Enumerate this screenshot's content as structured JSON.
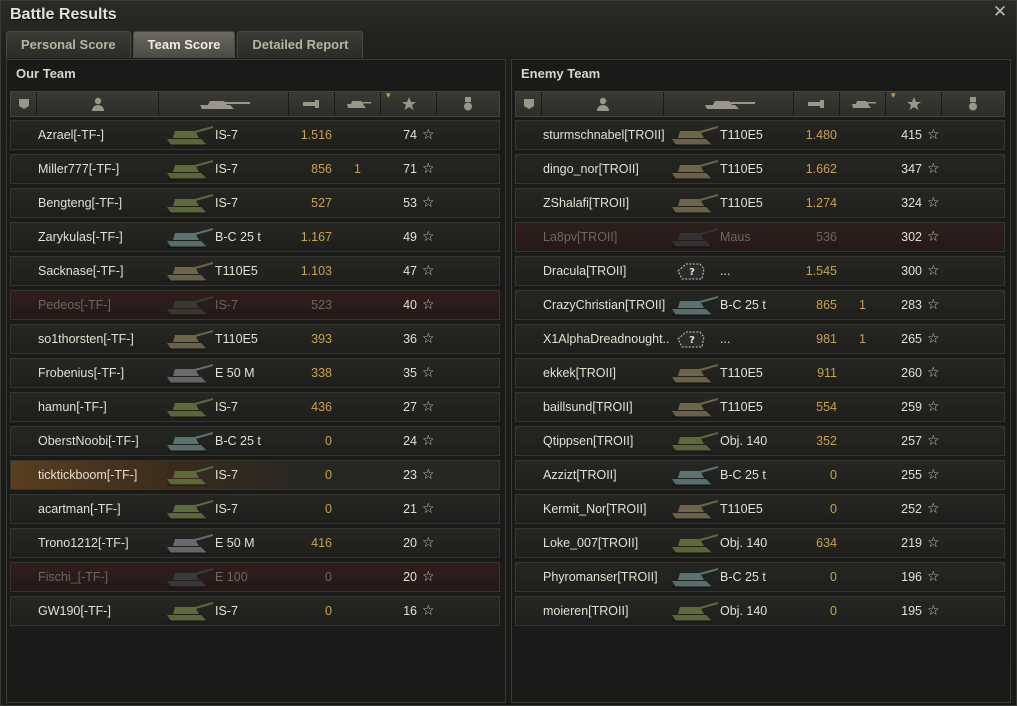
{
  "window": {
    "title": "Battle Results",
    "close_glyph": "✕"
  },
  "tabs": [
    {
      "label": "Personal Score",
      "active": false
    },
    {
      "label": "Team Score",
      "active": true
    },
    {
      "label": "Detailed Report",
      "active": false
    }
  ],
  "our_team": {
    "title": "Our Team",
    "rows": [
      {
        "name": "Azrael[-TF-]",
        "tank": "IS-7",
        "damage": "1.516",
        "kills": "",
        "xp": "74",
        "state": "normal",
        "tank_color": "#5d6b3a"
      },
      {
        "name": "Miller777[-TF-]",
        "tank": "IS-7",
        "damage": "856",
        "kills": "1",
        "xp": "71",
        "state": "normal",
        "tank_color": "#5d6b3a"
      },
      {
        "name": "Bengteng[-TF-]",
        "tank": "IS-7",
        "damage": "527",
        "kills": "",
        "xp": "53",
        "state": "normal",
        "tank_color": "#5d6b3a"
      },
      {
        "name": "Zarykulas[-TF-]",
        "tank": "B-C 25 t",
        "damage": "1.167",
        "kills": "",
        "xp": "49",
        "state": "normal",
        "tank_color": "#5b7371"
      },
      {
        "name": "Sacknase[-TF-]",
        "tank": "T110E5",
        "damage": "1.103",
        "kills": "",
        "xp": "47",
        "state": "normal",
        "tank_color": "#6e6448"
      },
      {
        "name": "Pedeos[-TF-]",
        "tank": "IS-7",
        "damage": "523",
        "kills": "",
        "xp": "40",
        "state": "dead",
        "tank_color": "#3a3a32"
      },
      {
        "name": "so1thorsten[-TF-]",
        "tank": "T110E5",
        "damage": "393",
        "kills": "",
        "xp": "36",
        "state": "normal",
        "tank_color": "#6e6448"
      },
      {
        "name": "Frobenius[-TF-]",
        "tank": "E 50 M",
        "damage": "338",
        "kills": "",
        "xp": "35",
        "state": "normal",
        "tank_color": "#6a6a6e"
      },
      {
        "name": "hamun[-TF-]",
        "tank": "IS-7",
        "damage": "436",
        "kills": "",
        "xp": "27",
        "state": "normal",
        "tank_color": "#5d6b3a"
      },
      {
        "name": "OberstNoobi[-TF-]",
        "tank": "B-C 25 t",
        "damage": "0",
        "kills": "",
        "xp": "24",
        "state": "normal",
        "tank_color": "#5b7371"
      },
      {
        "name": "ticktickboom[-TF-]",
        "tank": "IS-7",
        "damage": "0",
        "kills": "",
        "xp": "23",
        "state": "self",
        "tank_color": "#5d6b3a"
      },
      {
        "name": "acartman[-TF-]",
        "tank": "IS-7",
        "damage": "0",
        "kills": "",
        "xp": "21",
        "state": "normal",
        "tank_color": "#5d6b3a"
      },
      {
        "name": "Trono1212[-TF-]",
        "tank": "E 50 M",
        "damage": "416",
        "kills": "",
        "xp": "20",
        "state": "normal",
        "tank_color": "#6a6a6e"
      },
      {
        "name": "Fischi_[-TF-]",
        "tank": "E 100",
        "damage": "0",
        "kills": "",
        "xp": "20",
        "state": "dead",
        "tank_color": "#3a3a3e"
      },
      {
        "name": "GW190[-TF-]",
        "tank": "IS-7",
        "damage": "0",
        "kills": "",
        "xp": "16",
        "state": "normal",
        "tank_color": "#5d6b3a"
      }
    ]
  },
  "enemy_team": {
    "title": "Enemy Team",
    "rows": [
      {
        "name": "sturmschnabel[TROII]",
        "tank": "T110E5",
        "damage": "1.480",
        "kills": "",
        "xp": "415",
        "state": "normal",
        "tank_color": "#6e6448"
      },
      {
        "name": "dingo_nor[TROII]",
        "tank": "T110E5",
        "damage": "1.662",
        "kills": "",
        "xp": "347",
        "state": "normal",
        "tank_color": "#6e6448"
      },
      {
        "name": "ZShalafi[TROII]",
        "tank": "T110E5",
        "damage": "1.274",
        "kills": "",
        "xp": "324",
        "state": "normal",
        "tank_color": "#6e6448"
      },
      {
        "name": "La8pv[TROII]",
        "tank": "Maus",
        "damage": "536",
        "kills": "",
        "xp": "302",
        "state": "dead",
        "tank_color": "#333336"
      },
      {
        "name": "Dracula[TROII]",
        "tank": "...",
        "damage": "1.545",
        "kills": "",
        "xp": "300",
        "state": "unknown",
        "tank_color": "#2a2a2a"
      },
      {
        "name": "CrazyChristian[TROII]",
        "tank": "B-C 25 t",
        "damage": "865",
        "kills": "1",
        "xp": "283",
        "state": "normal",
        "tank_color": "#5b7371"
      },
      {
        "name": "X1AlphaDreadnought..",
        "tank": "...",
        "damage": "981",
        "kills": "1",
        "xp": "265",
        "state": "unknown",
        "tank_color": "#2a2a2a"
      },
      {
        "name": "ekkek[TROII]",
        "tank": "T110E5",
        "damage": "911",
        "kills": "",
        "xp": "260",
        "state": "normal",
        "tank_color": "#6e6448"
      },
      {
        "name": "baillsund[TROII]",
        "tank": "T110E5",
        "damage": "554",
        "kills": "",
        "xp": "259",
        "state": "normal",
        "tank_color": "#6e6448"
      },
      {
        "name": "Qtippsen[TROII]",
        "tank": "Obj. 140",
        "damage": "352",
        "kills": "",
        "xp": "257",
        "state": "normal",
        "tank_color": "#5d6b3a"
      },
      {
        "name": "Azzizt[TROII]",
        "tank": "B-C 25 t",
        "damage": "0",
        "kills": "",
        "xp": "255",
        "state": "normal",
        "tank_color": "#5b7371"
      },
      {
        "name": "Kermit_Nor[TROII]",
        "tank": "T110E5",
        "damage": "0",
        "kills": "",
        "xp": "252",
        "state": "normal",
        "tank_color": "#6e6448"
      },
      {
        "name": "Loke_007[TROII]",
        "tank": "Obj. 140",
        "damage": "634",
        "kills": "",
        "xp": "219",
        "state": "normal",
        "tank_color": "#5d6b3a"
      },
      {
        "name": "Phyromanser[TROII]",
        "tank": "B-C 25 t",
        "damage": "0",
        "kills": "",
        "xp": "196",
        "state": "normal",
        "tank_color": "#5b7371"
      },
      {
        "name": "moieren[TROII]",
        "tank": "Obj. 140",
        "damage": "0",
        "kills": "",
        "xp": "195",
        "state": "normal",
        "tank_color": "#5d6b3a"
      }
    ]
  },
  "colors": {
    "accent": "#c9a24a",
    "self_highlight": "#5a3e1f",
    "dead_row": "#2e1f1d"
  }
}
